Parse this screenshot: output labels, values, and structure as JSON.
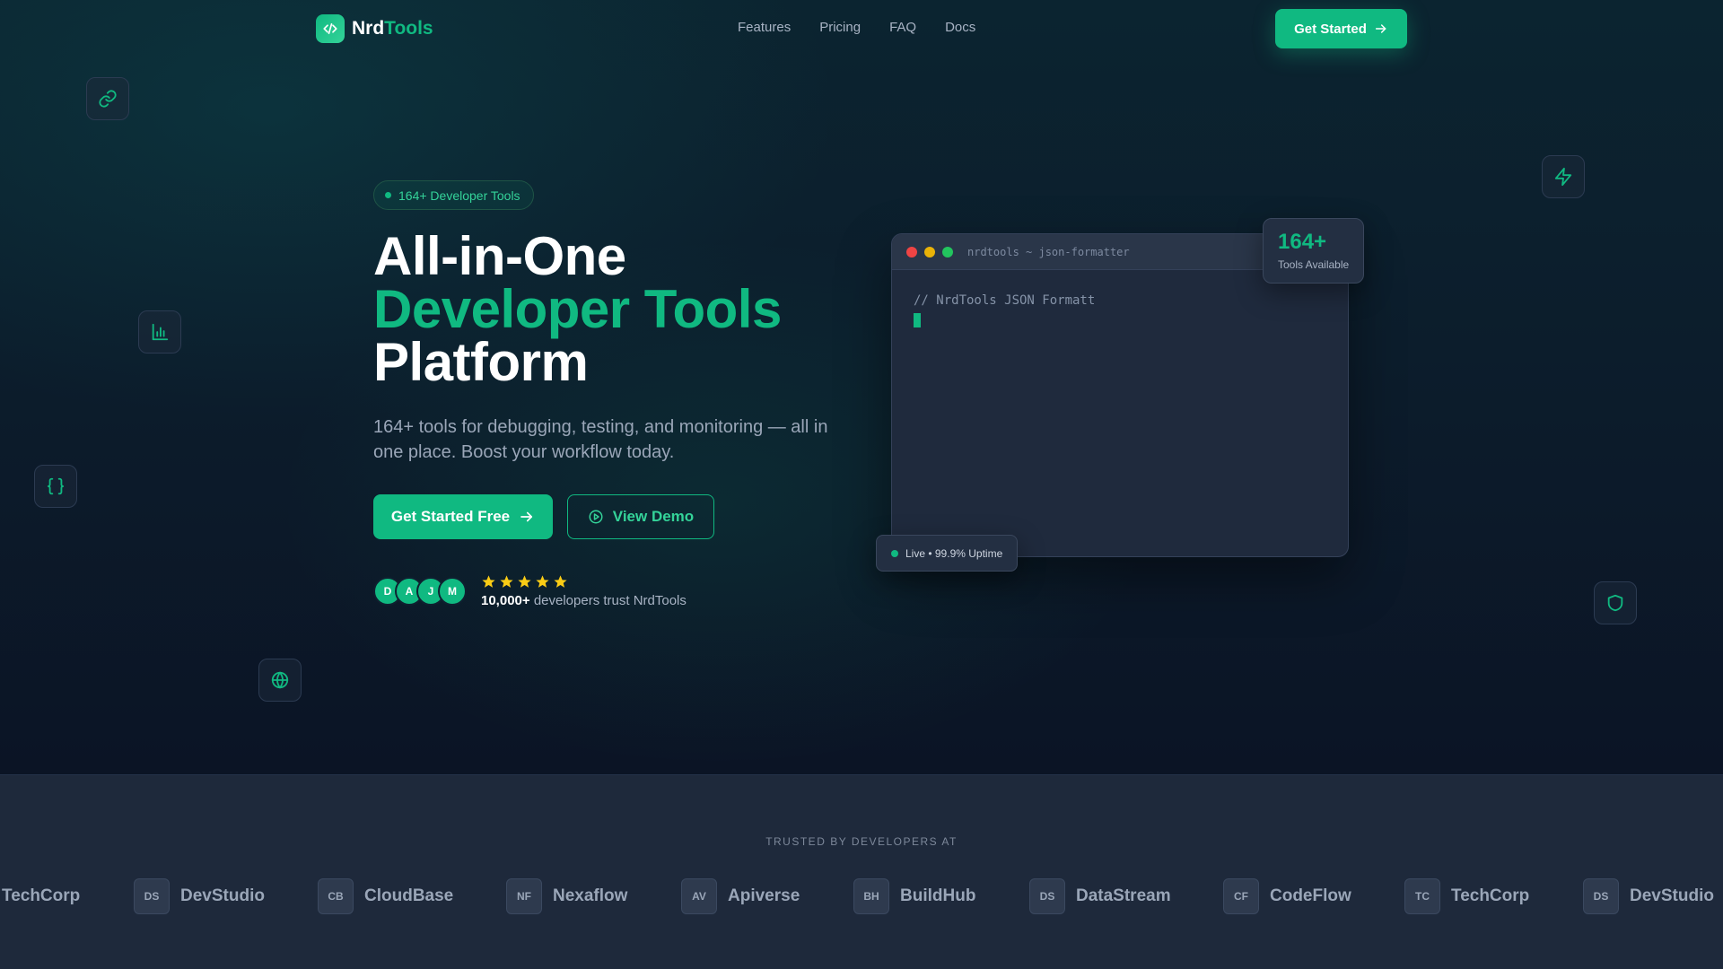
{
  "nav": {
    "brand_part1": "Nrd",
    "brand_part2": "Tools",
    "links": [
      "Features",
      "Pricing",
      "FAQ",
      "Docs"
    ],
    "cta_label": "Get Started"
  },
  "hero": {
    "badge": "164+ Developer Tools",
    "headline_line1": "All-in-One",
    "headline_line2": "Developer Tools",
    "headline_line3": "Platform",
    "subtitle": "164+ tools for debugging, testing, and monitoring — all in one place. Boost your workflow today.",
    "primary_cta": "Get Started Free",
    "secondary_cta": "View Demo",
    "avatars": [
      "D",
      "A",
      "J",
      "M"
    ],
    "rating_stars": 5,
    "trust_count": "10,000+",
    "trust_text": "developers trust NrdTools"
  },
  "code_window": {
    "title": "nrdtools ~ json-formatter",
    "code_line": "// NrdTools JSON Formatt"
  },
  "stat_card": {
    "value": "164+",
    "label": "Tools Available"
  },
  "uptime_card": {
    "text": "Live • 99.9% Uptime"
  },
  "trusted": {
    "label": "TRUSTED BY DEVELOPERS AT",
    "partial_first": "TechCorp",
    "logos": [
      {
        "abbr": "DS",
        "name": "DevStudio"
      },
      {
        "abbr": "CB",
        "name": "CloudBase"
      },
      {
        "abbr": "NF",
        "name": "Nexaflow"
      },
      {
        "abbr": "AV",
        "name": "Apiverse"
      },
      {
        "abbr": "BH",
        "name": "BuildHub"
      },
      {
        "abbr": "DS",
        "name": "DataStream"
      },
      {
        "abbr": "CF",
        "name": "CodeFlow"
      },
      {
        "abbr": "TC",
        "name": "TechCorp"
      },
      {
        "abbr": "DS",
        "name": "DevStudio"
      }
    ]
  },
  "icons": {
    "logo": "code-brackets-icon",
    "floating": [
      "link-icon",
      "bar-chart-icon",
      "curly-braces-icon",
      "globe-icon",
      "zap-icon",
      "shield-icon"
    ]
  },
  "colors": {
    "accent": "#10b981",
    "star": "#facc15",
    "dot_red": "#ef4444",
    "dot_yellow": "#eab308",
    "dot_green": "#22c55e"
  }
}
